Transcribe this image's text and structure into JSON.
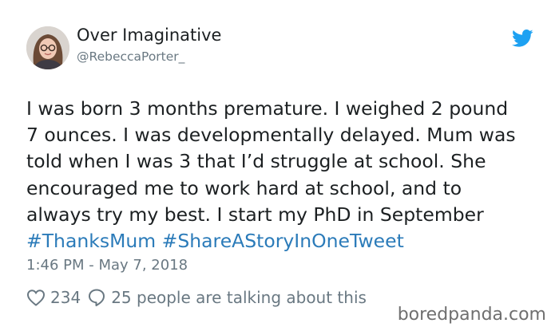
{
  "author": {
    "display_name": "Over Imaginative",
    "handle": "@RebeccaPorter_",
    "avatar_icon": "profile-photo"
  },
  "brand": {
    "icon": "twitter-bird-icon",
    "color": "#1da1f2"
  },
  "tweet": {
    "lines": [
      "I was born 3 months premature. I weighed 2 pound",
      "7 ounces. I was developmentally delayed. Mum was",
      "told when I was 3 that I’d struggle at school. She",
      "encouraged me to work hard at school, and to",
      "always try my best. I start my PhD in September"
    ],
    "hashtags": [
      "#ThanksMum",
      "#ShareAStoryInOneTweet"
    ],
    "timestamp": "1:46 PM - May 7, 2018"
  },
  "engagement": {
    "likes": "234",
    "replies_text": "25 people are talking about this",
    "like_icon": "heart-icon",
    "reply_icon": "speech-bubble-icon"
  },
  "watermark": "boredpanda.com",
  "colors": {
    "text": "#1c2022",
    "muted": "#697882",
    "link": "#2b7bb9"
  }
}
